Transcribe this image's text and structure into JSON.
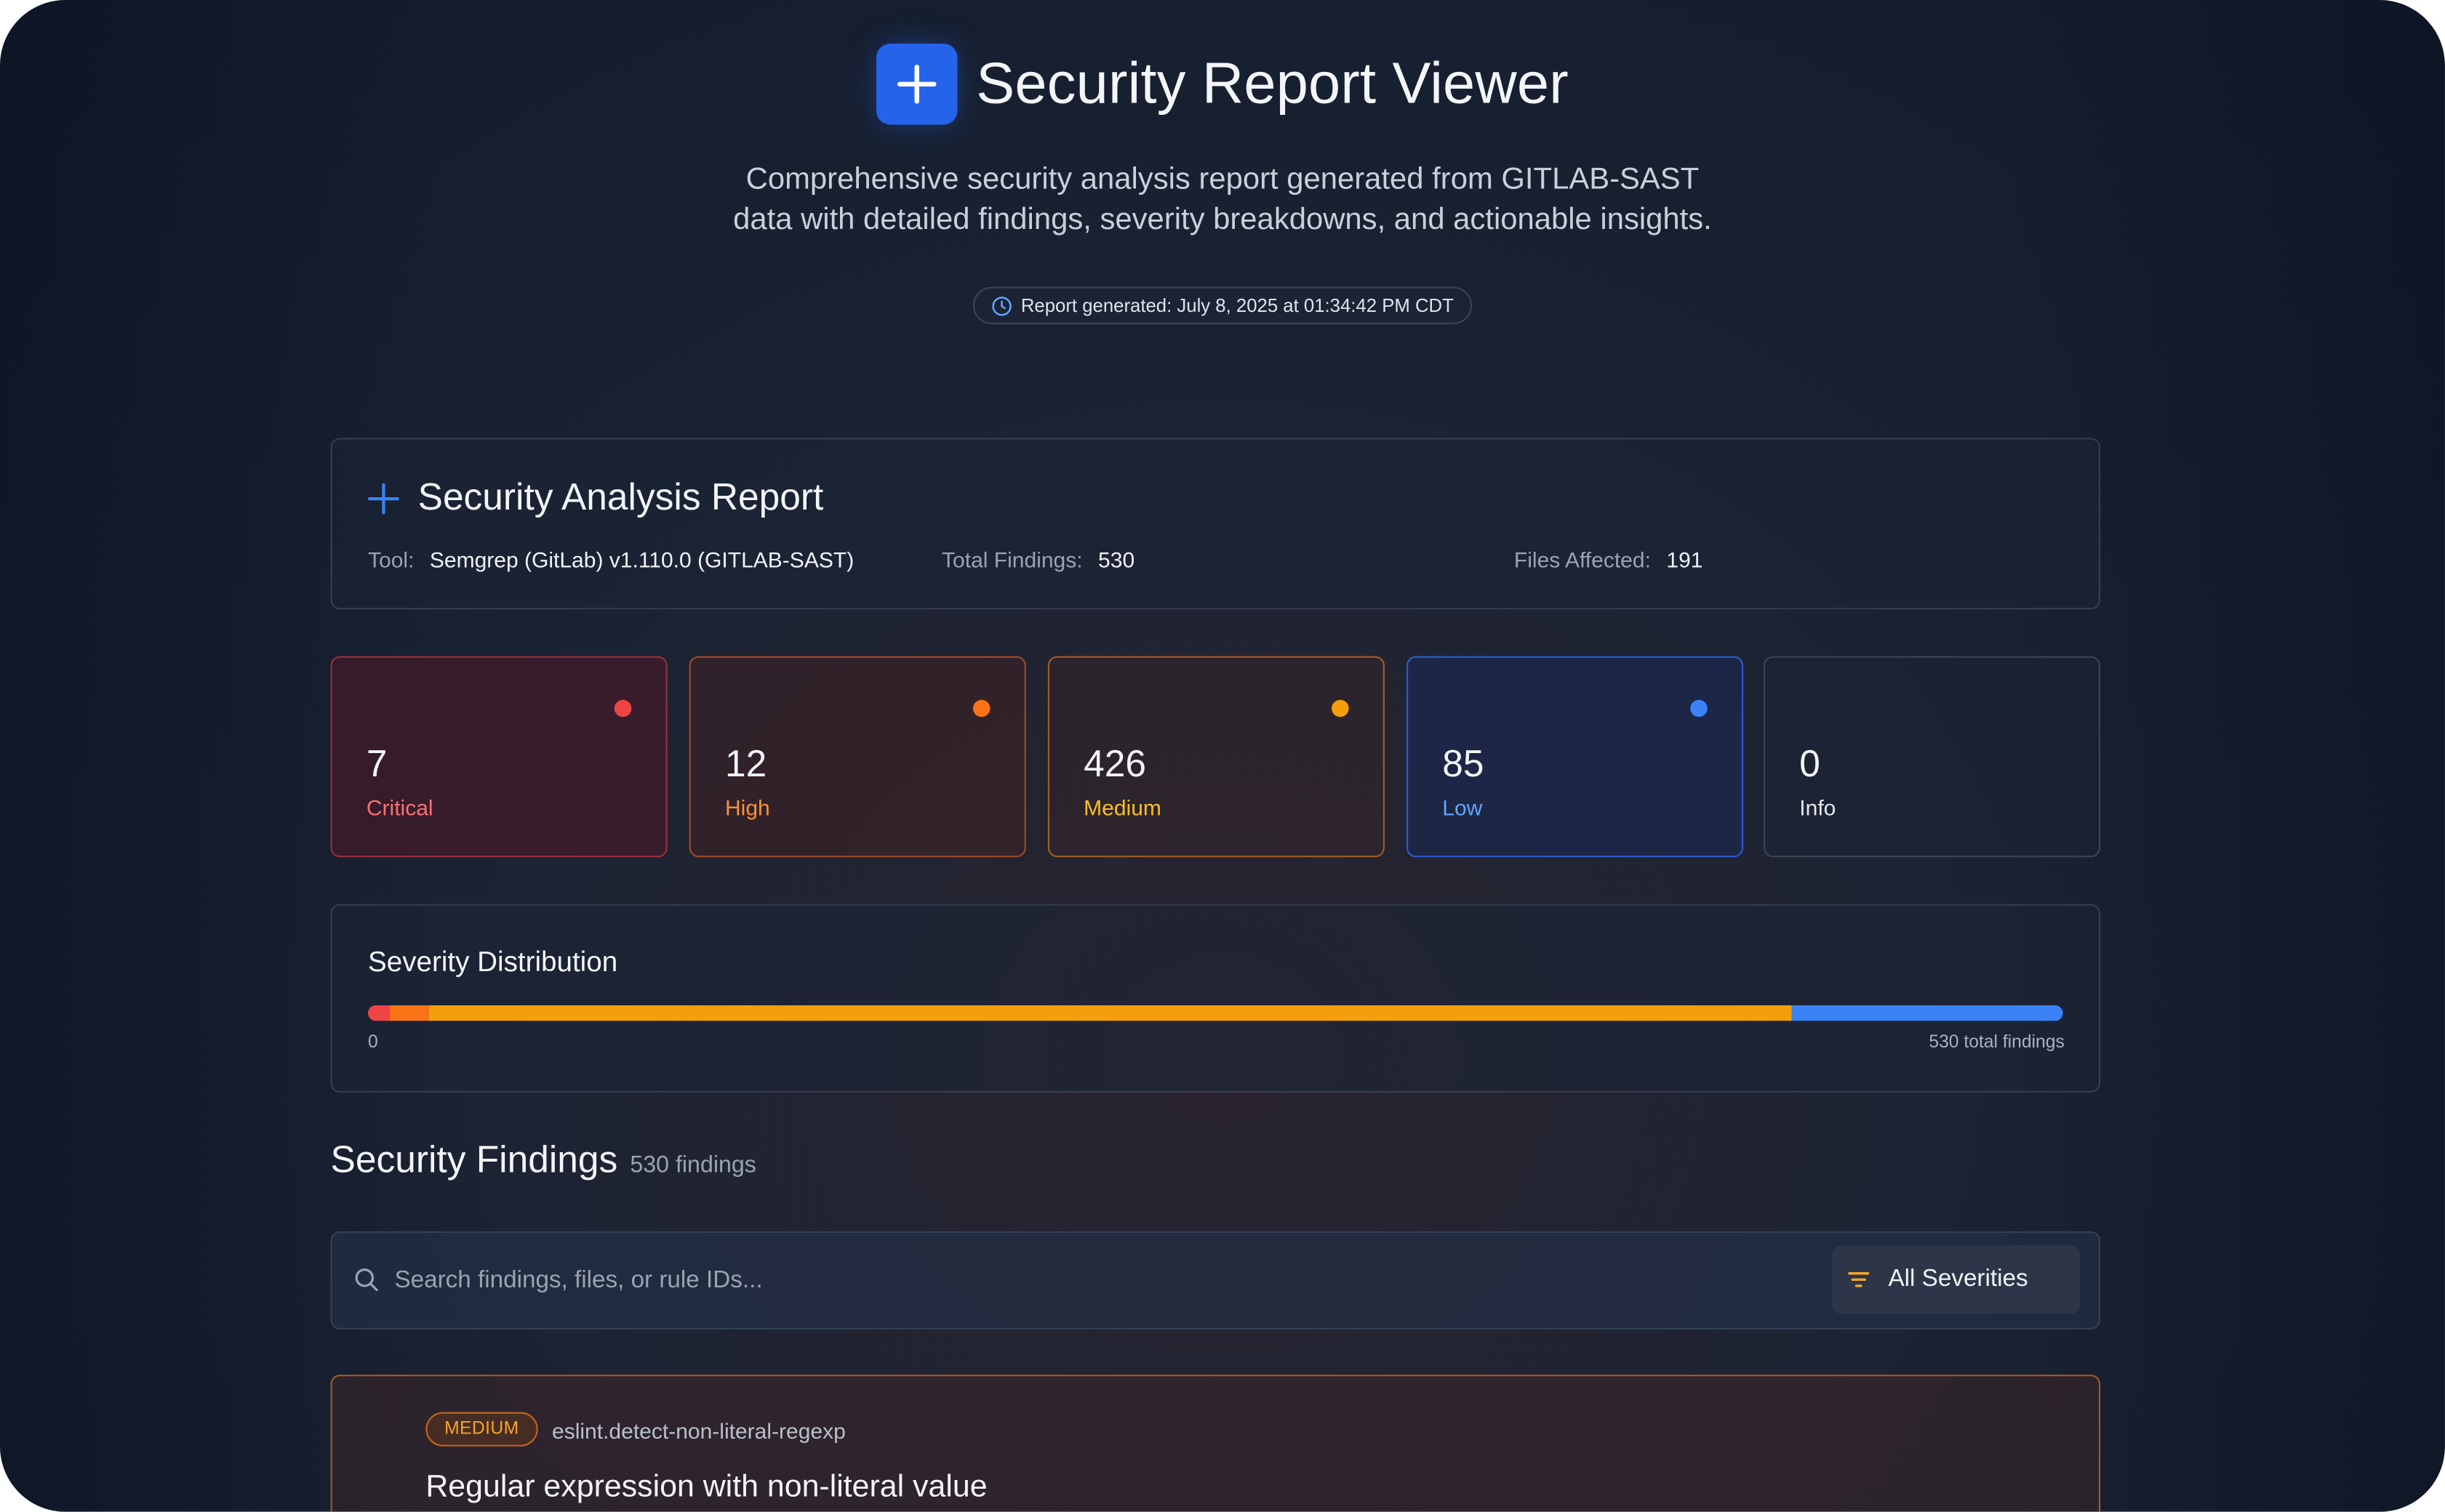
{
  "header": {
    "title": "Security Report Viewer",
    "subtitle": "Comprehensive security analysis report generated from GITLAB-SAST data with detailed findings, severity breakdowns, and actionable insights.",
    "generated": "Report generated: July 8, 2025 at 01:34:42 PM CDT",
    "logo_icon": "plus-icon",
    "clock_icon": "clock-icon"
  },
  "report": {
    "title": "Security Analysis Report",
    "tool_label": "Tool:",
    "tool_value": "Semgrep (GitLab) v1.110.0 (GITLAB-SAST)",
    "findings_label": "Total Findings:",
    "findings_value": "530",
    "files_label": "Files Affected:",
    "files_value": "191"
  },
  "severities": [
    {
      "count": "7",
      "label": "Critical",
      "color": "#ef4444",
      "label_color": "#f87171"
    },
    {
      "count": "12",
      "label": "High",
      "color": "#f97316",
      "label_color": "#fb923c"
    },
    {
      "count": "426",
      "label": "Medium",
      "color": "#f59e0b",
      "label_color": "#fbbf24"
    },
    {
      "count": "85",
      "label": "Low",
      "color": "#3b82f6",
      "label_color": "#60a5fa"
    },
    {
      "count": "0",
      "label": "Info",
      "color": "#9ca3af",
      "label_color": "#e5e7eb"
    }
  ],
  "distribution": {
    "title": "Severity Distribution",
    "min_label": "0",
    "max_label": "530 total findings",
    "total": 530,
    "segments": [
      {
        "name": "Critical",
        "value": 7,
        "color": "#ef4444"
      },
      {
        "name": "High",
        "value": 12,
        "color": "#f97316"
      },
      {
        "name": "Medium",
        "value": 426,
        "color": "#f59e0b"
      },
      {
        "name": "Low",
        "value": 85,
        "color": "#3b82f6"
      },
      {
        "name": "Info",
        "value": 0,
        "color": "#9ca3af"
      }
    ]
  },
  "findings": {
    "title": "Security Findings",
    "count": "530 findings",
    "search_placeholder": "Search findings, files, or rule IDs...",
    "severity_filter": "All Severities",
    "items": [
      {
        "severity": "MEDIUM",
        "rule_id": "eslint.detect-non-literal-regexp",
        "title": "Regular expression with non-literal value"
      }
    ]
  },
  "colors": {
    "accent": "#2563eb",
    "background": "#1b2333"
  }
}
